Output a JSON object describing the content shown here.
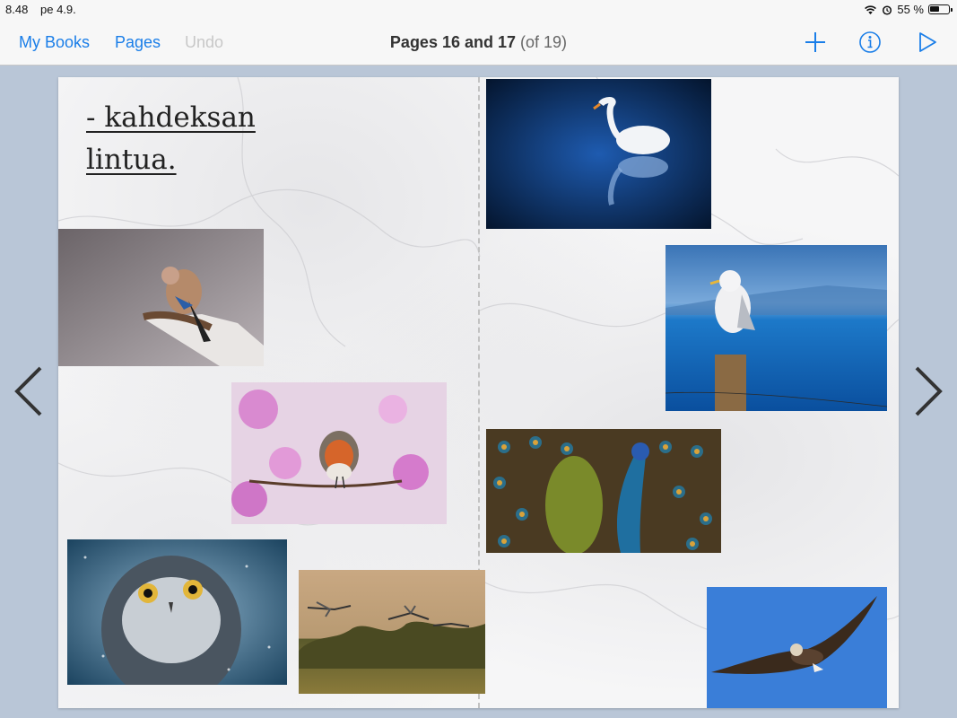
{
  "status": {
    "time": "8.48",
    "date": "pe 4.9.",
    "battery": "55 %",
    "battery_level": 0.55,
    "icons": [
      "wifi-icon",
      "alarm-icon",
      "battery-icon"
    ]
  },
  "toolbar": {
    "my_books": "My Books",
    "pages": "Pages",
    "undo": "Undo",
    "title_main": "Pages 16 and 17",
    "title_count": "(of 19)",
    "icons": [
      "add-icon",
      "info-icon",
      "play-icon"
    ],
    "accent": "#1a7ee8"
  },
  "page": {
    "heading_line1": "- kahdeksan",
    "heading_line2": "lintua.",
    "photos": [
      "jay",
      "swan",
      "robin",
      "seagull",
      "peacock",
      "owl",
      "cranes",
      "eagle"
    ]
  },
  "nav": {
    "prev": "chevron-left-icon",
    "next": "chevron-right-icon"
  }
}
